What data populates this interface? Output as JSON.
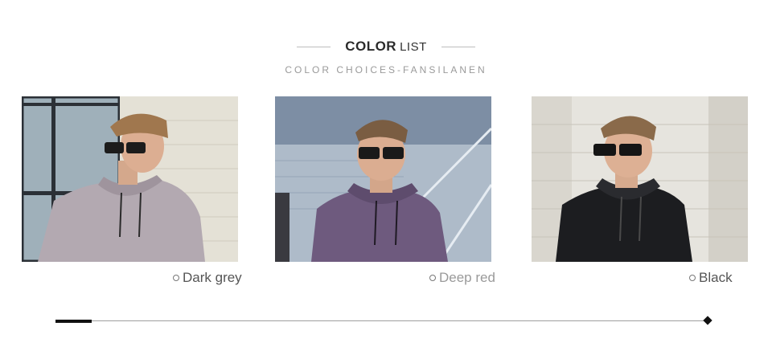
{
  "header": {
    "title_bold": "COLOR",
    "title_light": "LIST",
    "subtitle": "COLOR CHOICES-FANSILANEN"
  },
  "products": [
    {
      "label": "Dark grey",
      "hoodie_color": "#b3a9b1"
    },
    {
      "label": "Deep red",
      "hoodie_color": "#6e5a7e"
    },
    {
      "label": "Black",
      "hoodie_color": "#1c1d20"
    }
  ],
  "slider": {
    "position": 0.0
  }
}
